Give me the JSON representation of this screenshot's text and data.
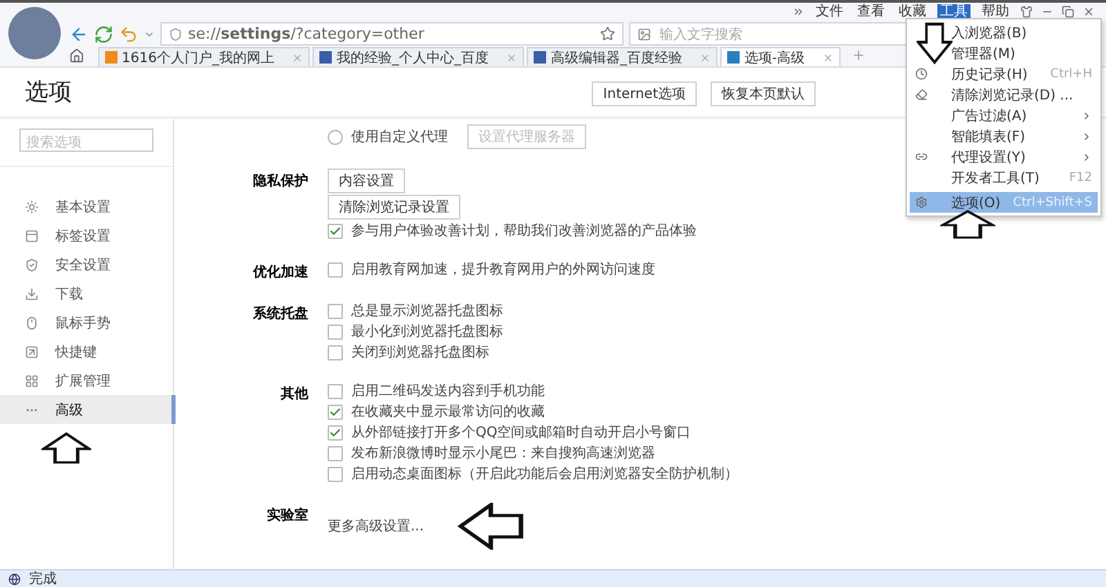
{
  "menubar": [
    {
      "label": "文件",
      "selected": false
    },
    {
      "label": "查看",
      "selected": false
    },
    {
      "label": "收藏",
      "selected": false
    },
    {
      "label": "工具",
      "selected": true
    },
    {
      "label": "帮助",
      "selected": false
    }
  ],
  "address": "se://**settings**/?category=other",
  "search": {
    "placeholder": "输入文字搜索"
  },
  "tabs": [
    {
      "label": "1616个人门户_我的网上",
      "selected": false
    },
    {
      "label": "我的经验_个人中心_百度",
      "selected": false
    },
    {
      "label": "高级编辑器_百度经验",
      "selected": false
    },
    {
      "label": "选项-高级",
      "selected": true
    }
  ],
  "tools_menu": [
    {
      "label": "入浏览器(B)",
      "submenu": false,
      "selected": false
    },
    {
      "label": "管理器(M)",
      "submenu": false,
      "selected": false
    },
    {
      "label": "历史记录(H)",
      "shortcut": "Ctrl+H",
      "submenu": false,
      "selected": false
    },
    {
      "label": "清除浏览记录(D) ...",
      "submenu": false,
      "selected": false
    },
    {
      "label": "广告过滤(A)",
      "submenu": true,
      "selected": false
    },
    {
      "label": "智能填表(F)",
      "submenu": true,
      "selected": false
    },
    {
      "label": "代理设置(Y)",
      "submenu": true,
      "selected": false
    },
    {
      "label": "开发者工具(T)",
      "shortcut": "F12",
      "submenu": false,
      "selected": false
    },
    {
      "label": "选项(O)",
      "shortcut": "Ctrl+Shift+S",
      "submenu": false,
      "selected": true
    }
  ],
  "page": {
    "title": "选项",
    "buttons": [
      "Internet选项",
      "恢复本页默认"
    ]
  },
  "sidebar": {
    "search_placeholder": "搜索选项",
    "items": [
      {
        "label": "基本设置",
        "selected": false
      },
      {
        "label": "标签设置",
        "selected": false
      },
      {
        "label": "安全设置",
        "selected": false
      },
      {
        "label": "下载",
        "selected": false
      },
      {
        "label": "鼠标手势",
        "selected": false
      },
      {
        "label": "快捷键",
        "selected": false
      },
      {
        "label": "扩展管理",
        "selected": false
      },
      {
        "label": "高级",
        "selected": true
      }
    ]
  },
  "sections": [
    {
      "items": [
        {
          "kind": "radio",
          "label": "使用自定义代理",
          "selected": false,
          "button": "设置代理服务器"
        }
      ]
    },
    {
      "label": "隐私保护",
      "items": [
        {
          "kind": "button",
          "label": "内容设置"
        },
        {
          "kind": "button",
          "label": "清除浏览记录设置"
        },
        {
          "kind": "checkbox",
          "label": "参与用户体验改善计划，帮助我们改善浏览器的产品体验",
          "checked": true
        }
      ]
    },
    {
      "label": "优化加速",
      "items": [
        {
          "kind": "checkbox",
          "label": "启用教育网加速，提升教育网用户的外网访问速度",
          "checked": false
        }
      ]
    },
    {
      "label": "系统托盘",
      "items": [
        {
          "kind": "checkbox",
          "label": "总是显示浏览器托盘图标",
          "checked": false
        },
        {
          "kind": "checkbox",
          "label": "最小化到浏览器托盘图标",
          "checked": false
        },
        {
          "kind": "checkbox",
          "label": "关闭到浏览器托盘图标",
          "checked": false
        }
      ]
    },
    {
      "label": "其他",
      "items": [
        {
          "kind": "checkbox",
          "label": "启用二维码发送内容到手机功能",
          "checked": false
        },
        {
          "kind": "checkbox",
          "label": "在收藏夹中显示最常访问的收藏",
          "checked": true
        },
        {
          "kind": "checkbox",
          "label": "从外部链接打开多个QQ空间或邮箱时自动开启小号窗口",
          "checked": true
        },
        {
          "kind": "checkbox",
          "label": "发布新浪微博时显示小尾巴：来自搜狗高速浏览器",
          "checked": false
        },
        {
          "kind": "checkbox",
          "label": "启用动态桌面图标（开启此功能后会启用浏览器安全防护机制）",
          "checked": false
        }
      ]
    },
    {
      "label": "实验室",
      "items": [
        {
          "kind": "link",
          "label": "更多高级设置..."
        }
      ]
    }
  ],
  "status": "完成"
}
